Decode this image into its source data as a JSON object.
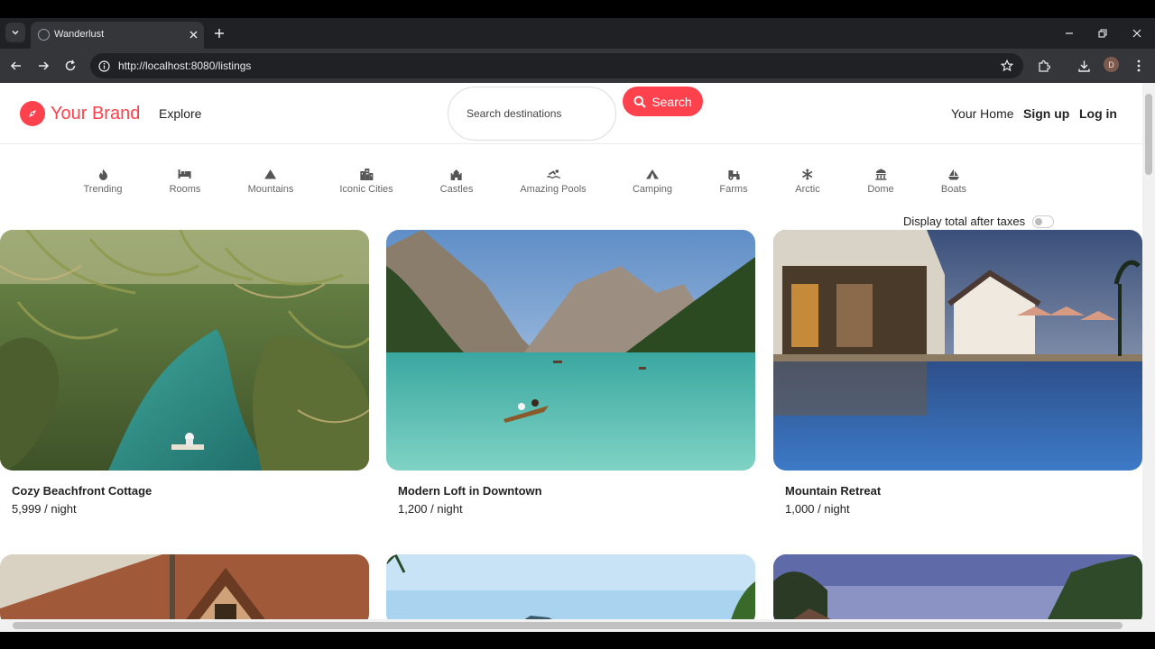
{
  "browser": {
    "tab_title": "Wanderlust",
    "url": "http://localhost:8080/listings",
    "profile_initial": "D"
  },
  "navbar": {
    "brand": "Your Brand",
    "explore": "Explore",
    "search_placeholder": "Search destinations",
    "search_button": "Search",
    "your_home": "Your Home",
    "sign_up": "Sign up",
    "log_in": "Log in",
    "brand_color": "#fe424d"
  },
  "filters": [
    {
      "label": "Trending",
      "icon": "fire-icon"
    },
    {
      "label": "Rooms",
      "icon": "bed-icon"
    },
    {
      "label": "Mountains",
      "icon": "mountain-icon"
    },
    {
      "label": "Iconic Cities",
      "icon": "city-icon"
    },
    {
      "label": "Castles",
      "icon": "castle-icon"
    },
    {
      "label": "Amazing Pools",
      "icon": "swimmer-icon"
    },
    {
      "label": "Camping",
      "icon": "tent-icon"
    },
    {
      "label": "Farms",
      "icon": "tractor-icon"
    },
    {
      "label": "Arctic",
      "icon": "snowflake-icon"
    },
    {
      "label": "Dome",
      "icon": "dome-icon"
    },
    {
      "label": "Boats",
      "icon": "sailboat-icon"
    }
  ],
  "tax_toggle": {
    "label": "Display total after taxes",
    "enabled": false
  },
  "listings": [
    {
      "title": "Cozy Beachfront Cottage",
      "price": "5,999 / night"
    },
    {
      "title": "Modern Loft in Downtown",
      "price": "1,200 / night"
    },
    {
      "title": "Mountain Retreat",
      "price": "1,000 / night"
    }
  ]
}
